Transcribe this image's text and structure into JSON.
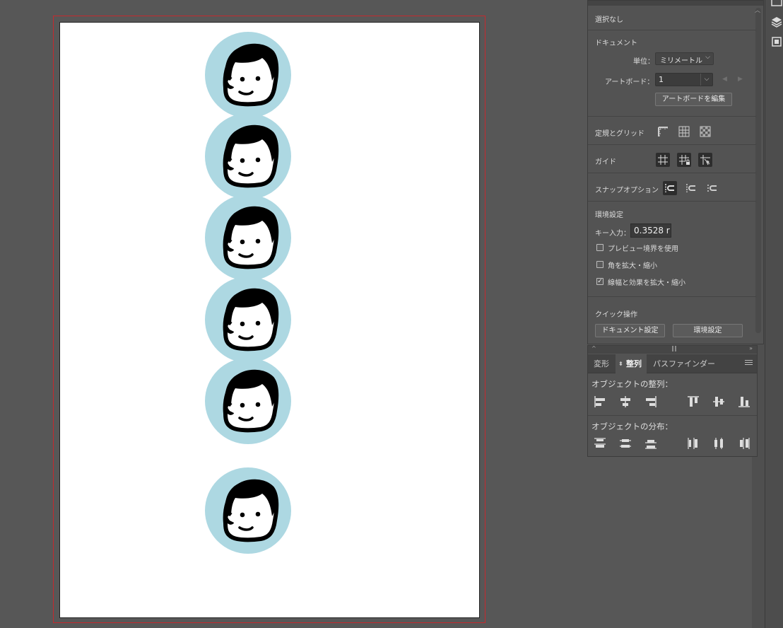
{
  "canvas": {
    "faces": [
      "face",
      "face",
      "face",
      "face",
      "face",
      "face"
    ],
    "colors": {
      "circle": "#add8e2",
      "bleed": "#c5292e",
      "artboard": "#ffffff"
    }
  },
  "properties_panel": {
    "selection": "選択なし",
    "document_heading": "ドキュメント",
    "units_label": "単位：",
    "units_value": "ミリメートル",
    "artboard_label": "アートボード：",
    "artboard_value": "1",
    "edit_artboard_button": "アートボードを編集",
    "rulers_grids_label": "定規とグリッド",
    "guides_label": "ガイド",
    "snap_label": "スナップオプション",
    "prefs_heading": "環境設定",
    "key_input_label": "キー入力：",
    "key_input_value": "0.3528 r",
    "checkboxes": [
      {
        "label": "プレビュー境界を使用",
        "checked": false
      },
      {
        "label": "角を拡大・縮小",
        "checked": false
      },
      {
        "label": "線幅と効果を拡大・縮小",
        "checked": true
      }
    ],
    "quick_heading": "クイック操作",
    "document_settings_button": "ドキュメント設定",
    "preferences_button": "環境設定"
  },
  "align_panel": {
    "tabs": [
      "変形",
      "整列",
      "パスファインダー"
    ],
    "active_tab": "整列",
    "align_objects_title": "オブジェクトの整列：",
    "distribute_objects_title": "オブジェクトの分布："
  }
}
